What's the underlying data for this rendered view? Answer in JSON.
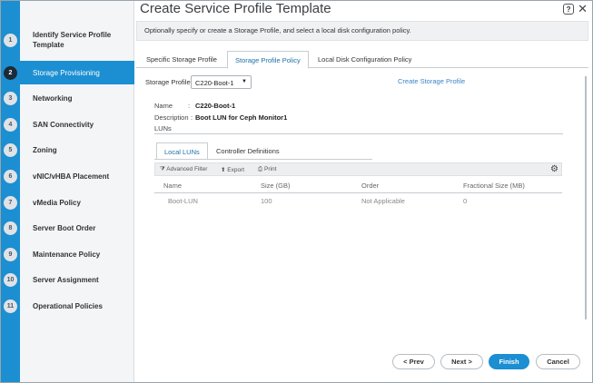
{
  "window": {
    "title": "Create Service Profile Template",
    "help_label": "?",
    "close_label": "✕"
  },
  "steps": [
    {
      "num": "1",
      "label": "Identify Service Profile Template"
    },
    {
      "num": "2",
      "label": "Storage Provisioning"
    },
    {
      "num": "3",
      "label": "Networking"
    },
    {
      "num": "4",
      "label": "SAN Connectivity"
    },
    {
      "num": "5",
      "label": "Zoning"
    },
    {
      "num": "6",
      "label": "vNIC/vHBA Placement"
    },
    {
      "num": "7",
      "label": "vMedia Policy"
    },
    {
      "num": "8",
      "label": "Server Boot Order"
    },
    {
      "num": "9",
      "label": "Maintenance Policy"
    },
    {
      "num": "10",
      "label": "Server Assignment"
    },
    {
      "num": "11",
      "label": "Operational Policies"
    }
  ],
  "active_step": 1,
  "description": "Optionally specify or create a Storage Profile, and select a local disk configuration policy.",
  "tabs": [
    "Specific Storage Profile",
    "Storage Profile Policy",
    "Local Disk Configuration Policy"
  ],
  "storage_profile": {
    "label": "Storage Profile:",
    "selected": "C220-Boot-1",
    "create_link": "Create Storage Profile"
  },
  "details": {
    "name_label": "Name",
    "name_sep": ":",
    "name_value": "C220-Boot-1",
    "desc_label": "Description",
    "desc_sep": ":",
    "desc_value": "Boot LUN for Ceph Monitor1",
    "luns_label": "LUNs"
  },
  "subtabs": [
    "Local LUNs",
    "Controller Definitions"
  ],
  "toolbar": {
    "filter": "Advanced Filter",
    "export": "Export",
    "print": "Print"
  },
  "table": {
    "columns": [
      "Name",
      "Size (GB)",
      "Order",
      "Fractional Size (MB)"
    ],
    "rows": [
      [
        "Boot-LUN",
        "100",
        "Not Applicable",
        "0"
      ]
    ]
  },
  "buttons": {
    "prev": "< Prev",
    "next": "Next >",
    "finish": "Finish",
    "cancel": "Cancel"
  },
  "colors": {
    "accent": "#1b8fd2",
    "link": "#3a86c4"
  }
}
